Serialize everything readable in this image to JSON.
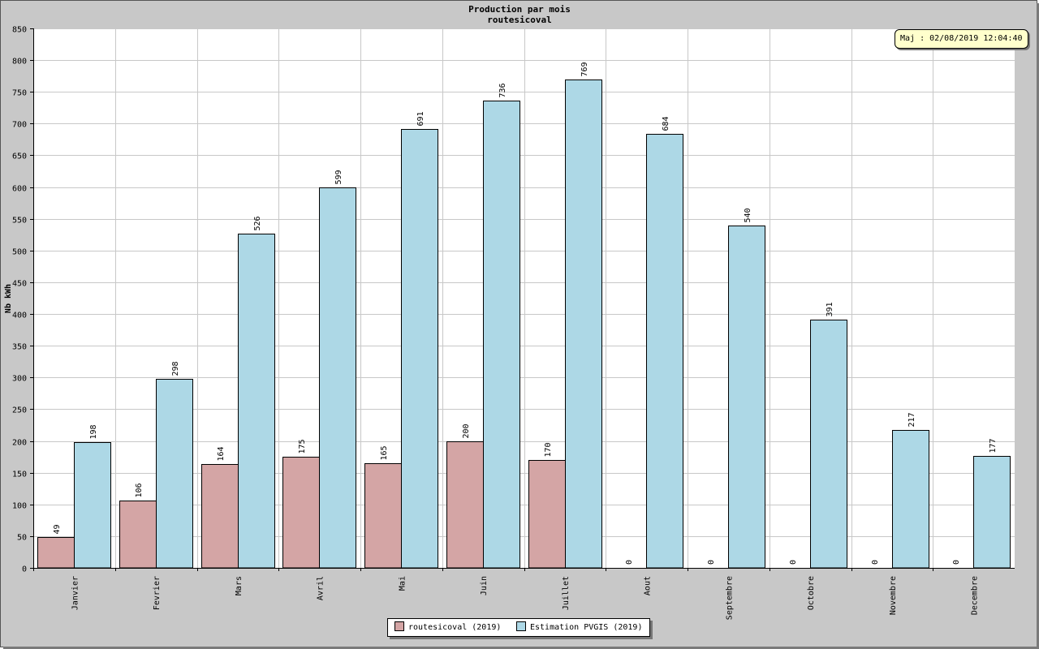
{
  "chart_data": {
    "type": "bar",
    "title": "Production par mois",
    "subtitle": "routesicoval",
    "ylabel": "Nb kWh",
    "xlabel": "",
    "ylim": [
      0,
      850
    ],
    "yticks": [
      0,
      50,
      100,
      150,
      200,
      250,
      300,
      350,
      400,
      450,
      500,
      550,
      600,
      650,
      700,
      750,
      800,
      850
    ],
    "categories": [
      "Janvier",
      "Fevrier",
      "Mars",
      "Avril",
      "Mai",
      "Juin",
      "Juillet",
      "Aout",
      "Septembre",
      "Octobre",
      "Novembre",
      "Decembre"
    ],
    "series": [
      {
        "name": "routesicoval (2019)",
        "color": "#d4a5a5",
        "values": [
          49,
          106,
          164,
          175,
          165,
          200,
          170,
          0,
          0,
          0,
          0,
          0
        ]
      },
      {
        "name": "Estimation PVGIS (2019)",
        "color": "#add8e6",
        "values": [
          198,
          298,
          526,
          599,
          691,
          736,
          769,
          684,
          540,
          391,
          217,
          177
        ]
      }
    ],
    "grid": true,
    "legend_position": "bottom-center",
    "update_label": "Maj : 02/08/2019 12:04:40"
  }
}
